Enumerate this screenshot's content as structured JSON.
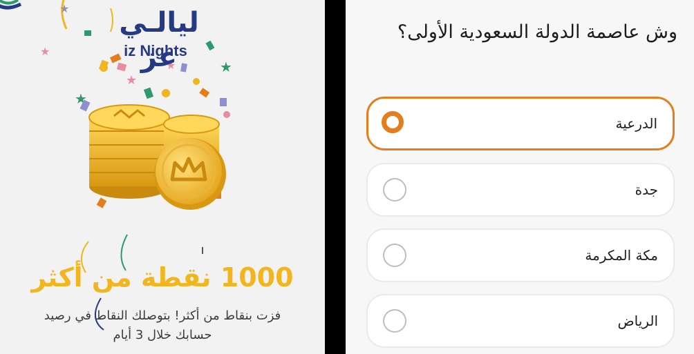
{
  "left_panel": {
    "logo": {
      "arabic": "ليالـي عز",
      "english": "iz Nights"
    },
    "reward": {
      "title": "1000 نقطة من أكثر",
      "description": "فزت بنقاط من أكثر! بتوصلك النقاط في رصيد حسابك خلال 3 أيام"
    }
  },
  "right_panel": {
    "question": "وش عاصمة الدولة السعودية الأولى؟",
    "options": [
      {
        "label": "الدرعية",
        "selected": true
      },
      {
        "label": "جدة",
        "selected": false
      },
      {
        "label": "مكة المكرمة",
        "selected": false
      },
      {
        "label": "الرياض",
        "selected": false
      }
    ]
  },
  "colors": {
    "accent_orange": "#e57d1d",
    "gold": "#f2b51d",
    "brand_navy": "#243a86"
  },
  "icons": [
    "confetti-decoration",
    "gold-coins-crown-icon",
    "radio-selected-icon",
    "radio-empty-icon"
  ]
}
